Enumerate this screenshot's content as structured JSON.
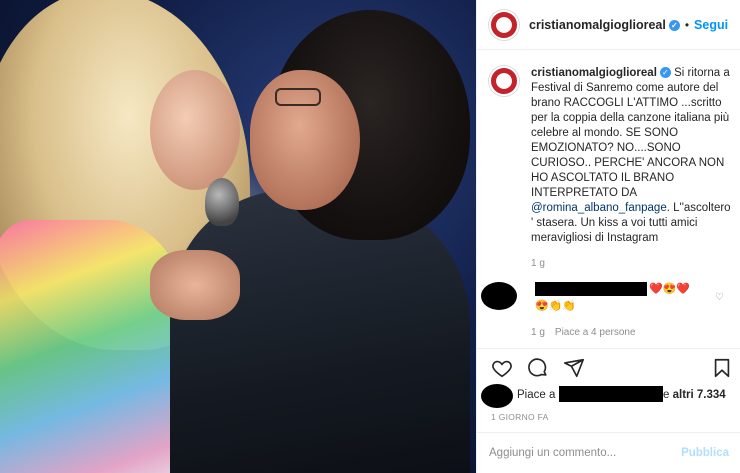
{
  "header": {
    "username": "cristianomalgioglioreal",
    "separator": "•",
    "follow_label": "Segui"
  },
  "caption": {
    "username": "cristianomalgioglioreal",
    "text_before_mention": "Si ritorna a Festival di Sanremo come autore del brano RACCOGLI L'ATTIMO ...scritto per la coppia della canzone italiana più celebre al mondo. SE SONO EMOZIONATO? NO....SONO CURIOSO.. PERCHE' ANCORA NON HO ASCOLTATO IL BRANO INTERPRETATO DA",
    "mention": "@romina_albano_fanpage",
    "text_after_mention": ". L''ascoltero ' stasera. Un kiss a voi tutti amici meravigliosi di Instagram",
    "time": "1 g"
  },
  "comment": {
    "emoji_line1": "❤️😍❤️",
    "emoji_line2": "😍👏👏",
    "time": "1 g",
    "likes": "Piace a 4 persone",
    "like_icon": "heart-outline-icon"
  },
  "actions": {
    "icons": [
      "heart-icon",
      "comment-icon",
      "share-icon",
      "bookmark-icon"
    ]
  },
  "likes": {
    "prefix": "Piace a",
    "middle": "e",
    "others": "altri 7.334"
  },
  "post_date": "1 GIORNO FA",
  "add_comment": {
    "placeholder": "Aggiungi un commento...",
    "publish_label": "Pubblica"
  },
  "colors": {
    "accent": "#0095f6",
    "verified": "#3897f0",
    "secondary_text": "#8e8e8e",
    "publish_disabled": "#b2dffc",
    "heart_red": "#ed4956"
  }
}
